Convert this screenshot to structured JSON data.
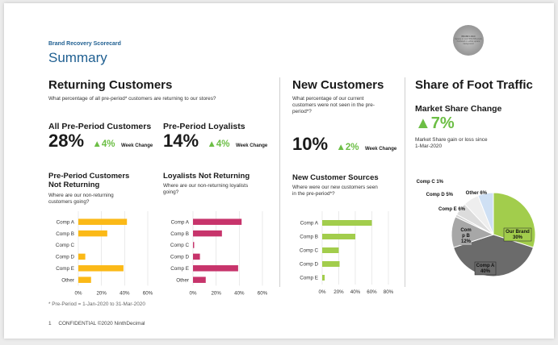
{
  "header": {
    "kicker": "Brand Recovery Scorecard",
    "title": "Summary",
    "logo_text_1": "BRAND LOGO",
    "logo_text_2": "Square or oval 300x300 pixels",
    "logo_text_3": "Centered on white square background"
  },
  "returning": {
    "title": "Returning Customers",
    "question": "What percentage of all pre-period* customers are returning to our stores?",
    "all": {
      "label": "All Pre-Period Customers",
      "value": "28%",
      "delta": "4%",
      "wk": "Week Change"
    },
    "loyal": {
      "label": "Pre-Period Loyalists",
      "value": "14%",
      "delta": "4%",
      "wk": "Week Change"
    },
    "not_returning": {
      "title_1": "Pre-Period Customers",
      "title_2": "Not Returning",
      "question_1": "Where are our non-returning",
      "question_2": "customers going?"
    },
    "loyal_not_returning": {
      "title": "Loyalists Not Returning",
      "question_1": "Where are our non-returning loyalists",
      "question_2": "going?"
    },
    "footnote": "* Pre-Period = 1-Jan-2020 to 31-Mar-2020"
  },
  "new_customers": {
    "title": "New Customers",
    "question_1": "What percentage of our current",
    "question_2": "customers were not seen in the pre-",
    "question_3": "period*?",
    "value": "10%",
    "delta": "2%",
    "wk": "Week Change",
    "sources_title": "New Customer Sources",
    "sources_q1": "Where were our new customers seen",
    "sources_q2": "in the pre-period*?"
  },
  "share": {
    "title": "Share of Foot Traffic",
    "subtitle": "Market Share Change",
    "value": "7%",
    "note_1": "Market Share gain or loss since",
    "note_2": "1-Mar-2020"
  },
  "footer": {
    "page": "1",
    "text": "CONFIDENTIAL ©2020 NinthDecimal"
  },
  "colors": {
    "gold": "#fbb917",
    "magenta": "#c7346b",
    "green": "#a2cd4c",
    "grid": "#e2e2e2",
    "up": "#6cbe45"
  },
  "chart_data": [
    {
      "id": "not-returning",
      "type": "bar",
      "categories": [
        "Comp A",
        "Comp B",
        "Comp C",
        "Comp D",
        "Comp E",
        "Other"
      ],
      "values": [
        42,
        25,
        0,
        6,
        39,
        11
      ],
      "xlim": [
        0,
        60
      ],
      "ticks": [
        "0%",
        "20%",
        "40%",
        "60%"
      ]
    },
    {
      "id": "loyal-not-returning",
      "type": "bar",
      "categories": [
        "Comp A",
        "Comp B",
        "Comp C",
        "Comp D",
        "Comp E",
        "Other"
      ],
      "values": [
        42,
        25,
        1,
        6,
        39,
        11
      ],
      "xlim": [
        0,
        60
      ],
      "ticks": [
        "0%",
        "20%",
        "40%",
        "60%"
      ]
    },
    {
      "id": "new-sources",
      "type": "bar",
      "categories": [
        "Comp A",
        "Comp B",
        "Comp C",
        "Comp D",
        "Comp E"
      ],
      "values": [
        60,
        40,
        20,
        21,
        3
      ],
      "xlim": [
        0,
        80
      ],
      "ticks": [
        "0%",
        "20%",
        "40%",
        "60%",
        "80%"
      ]
    },
    {
      "id": "foot-traffic-pie",
      "type": "pie",
      "labels": [
        "Our Brand",
        "Comp A",
        "Comp B",
        "Comp C",
        "Comp D",
        "Comp E",
        "Other"
      ],
      "values": [
        30,
        40,
        12,
        1,
        5,
        6,
        6
      ],
      "display": [
        "Our Brand 30%",
        "Comp A 40%",
        "Com p B 12%",
        "Comp C 1%",
        "Comp D 5%",
        "Comp E 6%",
        "Other 6%"
      ],
      "colors": [
        "#a2cd4c",
        "#6b6b6b",
        "#a7a7a7",
        "#d2d2d2",
        "#dcdcdc",
        "#eeeeee",
        "#cfe0f4"
      ]
    }
  ]
}
